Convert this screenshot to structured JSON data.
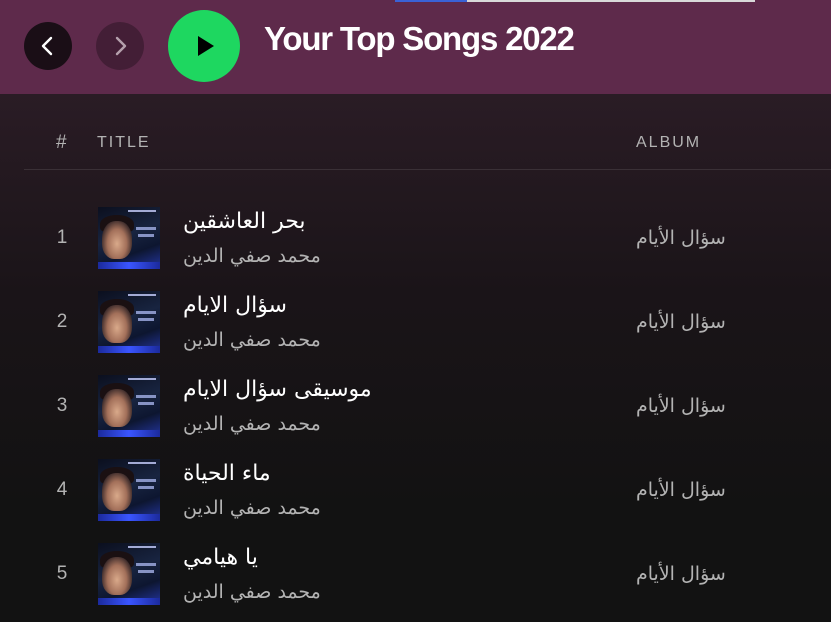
{
  "header": {
    "title": "Your Top Songs 2022",
    "back_icon": "chevron-left-icon",
    "forward_icon": "chevron-right-icon",
    "play_icon": "play-icon",
    "accent_color": "#1ed760",
    "header_color": "#5e2a4b"
  },
  "columns": {
    "number": "#",
    "title": "TITLE",
    "album": "ALBUM"
  },
  "tracks": [
    {
      "number": "1",
      "title": "بحر العاشقين",
      "artist": "محمد صفي الدين",
      "album": "سؤال الأيام"
    },
    {
      "number": "2",
      "title": "سؤال الايام",
      "artist": "محمد صفي الدين",
      "album": "سؤال الأيام"
    },
    {
      "number": "3",
      "title": "موسيقى سؤال الايام",
      "artist": "محمد صفي الدين",
      "album": "سؤال الأيام"
    },
    {
      "number": "4",
      "title": "ماء الحياة",
      "artist": "محمد صفي الدين",
      "album": "سؤال الأيام"
    },
    {
      "number": "5",
      "title": "يا هيامي",
      "artist": "محمد صفي الدين",
      "album": "سؤال الأيام"
    }
  ]
}
